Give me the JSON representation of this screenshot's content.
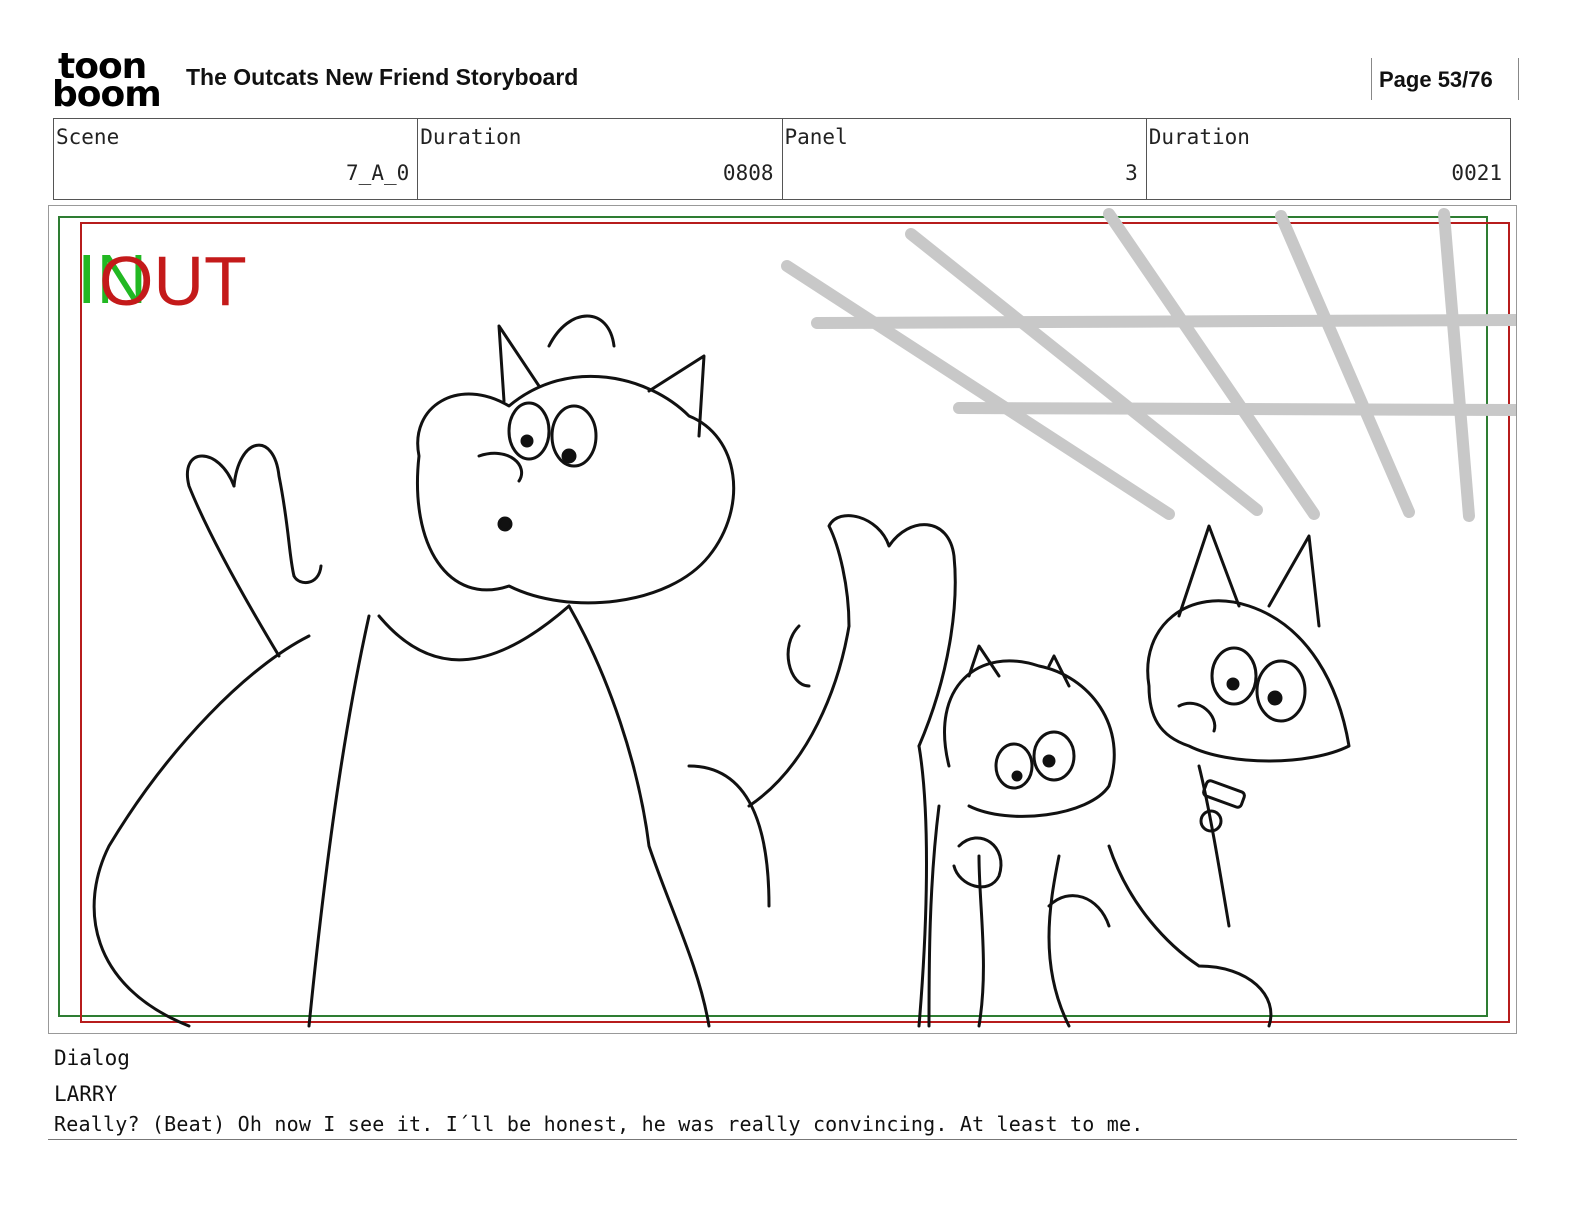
{
  "header": {
    "logo_line1": "toon",
    "logo_line2": "boom",
    "title": "The Outcats New Friend Storyboard",
    "page": "Page 53/76"
  },
  "info": {
    "scene_label": "Scene",
    "scene_value": "7_A_0",
    "scene_duration_label": "Duration",
    "scene_duration_value": "0808",
    "panel_label": "Panel",
    "panel_value": "3",
    "panel_duration_label": "Duration",
    "panel_duration_value": "0021"
  },
  "panel": {
    "in_marker": "IN",
    "out_marker": "OUT",
    "in_color": "#22b822",
    "out_color": "#c41a1a",
    "drawing": "storyboard sketch"
  },
  "dialog": {
    "label": "Dialog",
    "character": "LARRY",
    "line": "Really? (Beat) Oh now I see it. I´ll be honest, he was really convincing. At least to me."
  }
}
